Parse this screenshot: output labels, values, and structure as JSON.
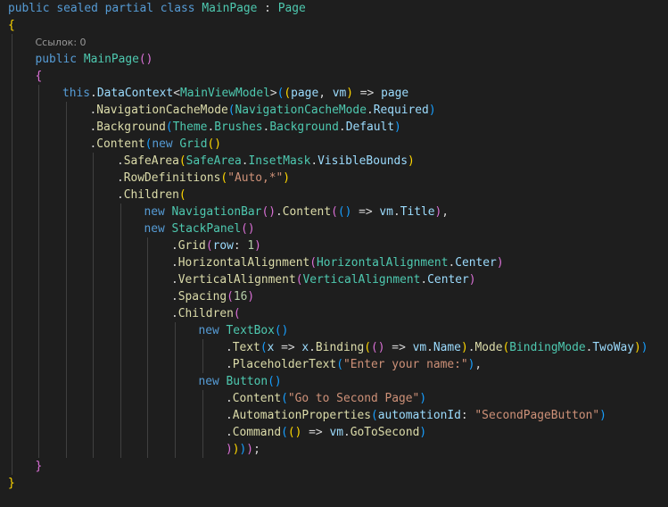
{
  "editor": {
    "background": "#1e1e1e",
    "codelens": "Ссылок: 0",
    "colors": {
      "keyword": "#569cd6",
      "type": "#4ec9b0",
      "function": "#dcdcaa",
      "variable": "#9cdcfe",
      "string": "#ce9178",
      "number": "#b5cea8",
      "bracket_gold": "#ffd700",
      "bracket_orchid": "#da70d6",
      "bracket_blue": "#179fff",
      "codelens": "#999999",
      "indent_guide": "#404040"
    },
    "lines": [
      {
        "indent": 0,
        "tokens": [
          [
            "kw",
            "public sealed partial class "
          ],
          [
            "type",
            "MainPage"
          ],
          [
            "punc",
            " : "
          ],
          [
            "type",
            "Page"
          ]
        ]
      },
      {
        "indent": 0,
        "tokens": [
          [
            "b1",
            "{"
          ]
        ]
      },
      {
        "indent": 1,
        "lens": true,
        "tokens": []
      },
      {
        "indent": 1,
        "tokens": [
          [
            "kw",
            "public "
          ],
          [
            "type",
            "MainPage"
          ],
          [
            "b2",
            "()"
          ]
        ]
      },
      {
        "indent": 1,
        "tokens": [
          [
            "b2",
            "{"
          ]
        ]
      },
      {
        "indent": 2,
        "tokens": [
          [
            "kw",
            "this"
          ],
          [
            "punc",
            "."
          ],
          [
            "var",
            "DataContext"
          ],
          [
            "punc",
            "<"
          ],
          [
            "type",
            "MainViewModel"
          ],
          [
            "punc",
            ">"
          ],
          [
            "b3",
            "("
          ],
          [
            "b1",
            "("
          ],
          [
            "var",
            "page"
          ],
          [
            "punc",
            ", "
          ],
          [
            "var",
            "vm"
          ],
          [
            "b1",
            ")"
          ],
          [
            "punc",
            " => "
          ],
          [
            "var",
            "page"
          ]
        ]
      },
      {
        "indent": 3,
        "tokens": [
          [
            "punc",
            "."
          ],
          [
            "fn",
            "NavigationCacheMode"
          ],
          [
            "b3",
            "("
          ],
          [
            "type",
            "NavigationCacheMode"
          ],
          [
            "punc",
            "."
          ],
          [
            "var",
            "Required"
          ],
          [
            "b3",
            ")"
          ]
        ]
      },
      {
        "indent": 3,
        "tokens": [
          [
            "punc",
            "."
          ],
          [
            "fn",
            "Background"
          ],
          [
            "b3",
            "("
          ],
          [
            "type",
            "Theme"
          ],
          [
            "punc",
            "."
          ],
          [
            "type",
            "Brushes"
          ],
          [
            "punc",
            "."
          ],
          [
            "type",
            "Background"
          ],
          [
            "punc",
            "."
          ],
          [
            "var",
            "Default"
          ],
          [
            "b3",
            ")"
          ]
        ]
      },
      {
        "indent": 3,
        "tokens": [
          [
            "punc",
            "."
          ],
          [
            "fn",
            "Content"
          ],
          [
            "b3",
            "("
          ],
          [
            "kw",
            "new "
          ],
          [
            "type",
            "Grid"
          ],
          [
            "b1",
            "()"
          ]
        ]
      },
      {
        "indent": 4,
        "tokens": [
          [
            "punc",
            "."
          ],
          [
            "fn",
            "SafeArea"
          ],
          [
            "b1",
            "("
          ],
          [
            "type",
            "SafeArea"
          ],
          [
            "punc",
            "."
          ],
          [
            "type",
            "InsetMask"
          ],
          [
            "punc",
            "."
          ],
          [
            "var",
            "VisibleBounds"
          ],
          [
            "b1",
            ")"
          ]
        ]
      },
      {
        "indent": 4,
        "tokens": [
          [
            "punc",
            "."
          ],
          [
            "fn",
            "RowDefinitions"
          ],
          [
            "b1",
            "("
          ],
          [
            "str",
            "\"Auto,*\""
          ],
          [
            "b1",
            ")"
          ]
        ]
      },
      {
        "indent": 4,
        "tokens": [
          [
            "punc",
            "."
          ],
          [
            "fn",
            "Children"
          ],
          [
            "b1",
            "("
          ]
        ]
      },
      {
        "indent": 5,
        "tokens": [
          [
            "kw",
            "new "
          ],
          [
            "type",
            "NavigationBar"
          ],
          [
            "b2",
            "()"
          ],
          [
            "punc",
            "."
          ],
          [
            "fn",
            "Content"
          ],
          [
            "b2",
            "("
          ],
          [
            "b3",
            "()"
          ],
          [
            "punc",
            " => "
          ],
          [
            "var",
            "vm"
          ],
          [
            "punc",
            "."
          ],
          [
            "var",
            "Title"
          ],
          [
            "b2",
            ")"
          ],
          [
            "punc",
            ","
          ]
        ]
      },
      {
        "indent": 5,
        "tokens": [
          [
            "kw",
            "new "
          ],
          [
            "type",
            "StackPanel"
          ],
          [
            "b2",
            "()"
          ]
        ]
      },
      {
        "indent": 6,
        "tokens": [
          [
            "punc",
            "."
          ],
          [
            "fn",
            "Grid"
          ],
          [
            "b2",
            "("
          ],
          [
            "var",
            "row"
          ],
          [
            "punc",
            ": "
          ],
          [
            "num",
            "1"
          ],
          [
            "b2",
            ")"
          ]
        ]
      },
      {
        "indent": 6,
        "tokens": [
          [
            "punc",
            "."
          ],
          [
            "fn",
            "HorizontalAlignment"
          ],
          [
            "b2",
            "("
          ],
          [
            "type",
            "HorizontalAlignment"
          ],
          [
            "punc",
            "."
          ],
          [
            "var",
            "Center"
          ],
          [
            "b2",
            ")"
          ]
        ]
      },
      {
        "indent": 6,
        "tokens": [
          [
            "punc",
            "."
          ],
          [
            "fn",
            "VerticalAlignment"
          ],
          [
            "b2",
            "("
          ],
          [
            "type",
            "VerticalAlignment"
          ],
          [
            "punc",
            "."
          ],
          [
            "var",
            "Center"
          ],
          [
            "b2",
            ")"
          ]
        ]
      },
      {
        "indent": 6,
        "tokens": [
          [
            "punc",
            "."
          ],
          [
            "fn",
            "Spacing"
          ],
          [
            "b2",
            "("
          ],
          [
            "num",
            "16"
          ],
          [
            "b2",
            ")"
          ]
        ]
      },
      {
        "indent": 6,
        "tokens": [
          [
            "punc",
            "."
          ],
          [
            "fn",
            "Children"
          ],
          [
            "b2",
            "("
          ]
        ]
      },
      {
        "indent": 7,
        "tokens": [
          [
            "kw",
            "new "
          ],
          [
            "type",
            "TextBox"
          ],
          [
            "b3",
            "()"
          ]
        ]
      },
      {
        "indent": 8,
        "tokens": [
          [
            "punc",
            "."
          ],
          [
            "fn",
            "Text"
          ],
          [
            "b3",
            "("
          ],
          [
            "var",
            "x"
          ],
          [
            "punc",
            " => "
          ],
          [
            "var",
            "x"
          ],
          [
            "punc",
            "."
          ],
          [
            "fn",
            "Binding"
          ],
          [
            "b1",
            "("
          ],
          [
            "b2",
            "()"
          ],
          [
            "punc",
            " => "
          ],
          [
            "var",
            "vm"
          ],
          [
            "punc",
            "."
          ],
          [
            "var",
            "Name"
          ],
          [
            "b1",
            ")"
          ],
          [
            "punc",
            "."
          ],
          [
            "fn",
            "Mode"
          ],
          [
            "b1",
            "("
          ],
          [
            "type",
            "BindingMode"
          ],
          [
            "punc",
            "."
          ],
          [
            "var",
            "TwoWay"
          ],
          [
            "b1",
            ")"
          ],
          [
            "b3",
            ")"
          ]
        ]
      },
      {
        "indent": 8,
        "tokens": [
          [
            "punc",
            "."
          ],
          [
            "fn",
            "PlaceholderText"
          ],
          [
            "b3",
            "("
          ],
          [
            "str",
            "\"Enter your name:\""
          ],
          [
            "b3",
            ")"
          ],
          [
            "punc",
            ","
          ]
        ]
      },
      {
        "indent": 7,
        "tokens": [
          [
            "kw",
            "new "
          ],
          [
            "type",
            "Button"
          ],
          [
            "b3",
            "()"
          ]
        ]
      },
      {
        "indent": 8,
        "tokens": [
          [
            "punc",
            "."
          ],
          [
            "fn",
            "Content"
          ],
          [
            "b3",
            "("
          ],
          [
            "str",
            "\"Go to Second Page\""
          ],
          [
            "b3",
            ")"
          ]
        ]
      },
      {
        "indent": 8,
        "tokens": [
          [
            "punc",
            "."
          ],
          [
            "fn",
            "AutomationProperties"
          ],
          [
            "b3",
            "("
          ],
          [
            "var",
            "automationId"
          ],
          [
            "punc",
            ": "
          ],
          [
            "str",
            "\"SecondPageButton\""
          ],
          [
            "b3",
            ")"
          ]
        ]
      },
      {
        "indent": 8,
        "tokens": [
          [
            "punc",
            "."
          ],
          [
            "fn",
            "Command"
          ],
          [
            "b3",
            "("
          ],
          [
            "b1",
            "()"
          ],
          [
            "punc",
            " => "
          ],
          [
            "var",
            "vm"
          ],
          [
            "punc",
            "."
          ],
          [
            "fn",
            "GoToSecond"
          ],
          [
            "b3",
            ")"
          ]
        ]
      },
      {
        "indent": 8,
        "tokens": [
          [
            "b2",
            ")"
          ],
          [
            "b1",
            ")"
          ],
          [
            "b3",
            ")"
          ],
          [
            "b2",
            ")"
          ],
          [
            "punc",
            ";"
          ]
        ]
      },
      {
        "indent": 1,
        "tokens": [
          [
            "b2",
            "}"
          ]
        ]
      },
      {
        "indent": 0,
        "tokens": [
          [
            "b1",
            "}"
          ]
        ]
      }
    ]
  }
}
